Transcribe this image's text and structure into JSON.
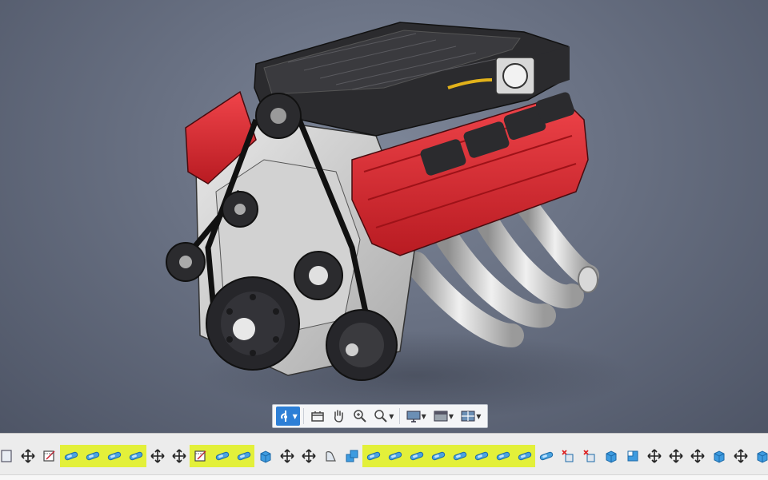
{
  "scene": {
    "description_label": "",
    "colors": {
      "background": "#5c6272",
      "engine_red": "#d8232a",
      "engine_dark": "#2b2b2e",
      "engine_silver": "#c9c9c9",
      "highlight": "#e3f03a",
      "accent": "#2d7fd6"
    }
  },
  "navigation_bar": {
    "buttons": [
      {
        "icon": "orbit-icon",
        "active": true,
        "has_menu": true
      },
      {
        "icon": "look-at-icon",
        "active": false,
        "has_menu": false
      },
      {
        "icon": "pan-icon",
        "active": false,
        "has_menu": false
      },
      {
        "icon": "zoom-window-icon",
        "active": false,
        "has_menu": false
      },
      {
        "icon": "zoom-icon",
        "active": false,
        "has_menu": true
      },
      {
        "icon": "display-settings-icon",
        "active": false,
        "has_menu": true
      },
      {
        "icon": "visual-style-icon",
        "active": false,
        "has_menu": true
      },
      {
        "icon": "viewports-icon",
        "active": false,
        "has_menu": true
      }
    ]
  },
  "timeline": {
    "items": [
      {
        "icon": "component-icon",
        "highlighted": false
      },
      {
        "icon": "move-icon",
        "highlighted": false
      },
      {
        "icon": "sketch-icon",
        "highlighted": false
      },
      {
        "icon": "joint-icon",
        "highlighted": true
      },
      {
        "icon": "joint-icon",
        "highlighted": true
      },
      {
        "icon": "joint-icon",
        "highlighted": true
      },
      {
        "icon": "joint-icon",
        "highlighted": true
      },
      {
        "icon": "move-icon",
        "highlighted": false
      },
      {
        "icon": "move-icon",
        "highlighted": false
      },
      {
        "icon": "sketch-icon",
        "highlighted": true
      },
      {
        "icon": "joint-icon",
        "highlighted": true
      },
      {
        "icon": "joint-icon",
        "highlighted": true
      },
      {
        "icon": "extrude-icon",
        "highlighted": false
      },
      {
        "icon": "move-icon",
        "highlighted": false
      },
      {
        "icon": "move-icon",
        "highlighted": false
      },
      {
        "icon": "revolve-icon",
        "highlighted": false
      },
      {
        "icon": "combine-icon",
        "highlighted": false
      },
      {
        "icon": "joint-icon",
        "highlighted": true
      },
      {
        "icon": "joint-icon",
        "highlighted": true
      },
      {
        "icon": "joint-icon",
        "highlighted": true
      },
      {
        "icon": "joint-icon",
        "highlighted": true
      },
      {
        "icon": "joint-icon",
        "highlighted": true
      },
      {
        "icon": "joint-icon",
        "highlighted": true
      },
      {
        "icon": "joint-icon",
        "highlighted": true
      },
      {
        "icon": "joint-icon",
        "highlighted": true
      },
      {
        "icon": "joint-icon",
        "highlighted": false
      },
      {
        "icon": "delete-body-icon",
        "highlighted": false
      },
      {
        "icon": "delete-body-icon",
        "highlighted": false
      },
      {
        "icon": "extrude-icon",
        "highlighted": false
      },
      {
        "icon": "press-pull-icon",
        "highlighted": false
      },
      {
        "icon": "move-icon",
        "highlighted": false
      },
      {
        "icon": "move-icon",
        "highlighted": false
      },
      {
        "icon": "move-icon",
        "highlighted": false
      },
      {
        "icon": "extrude-icon",
        "highlighted": false
      },
      {
        "icon": "move-icon",
        "highlighted": false
      },
      {
        "icon": "extrude-icon",
        "highlighted": false
      }
    ]
  }
}
